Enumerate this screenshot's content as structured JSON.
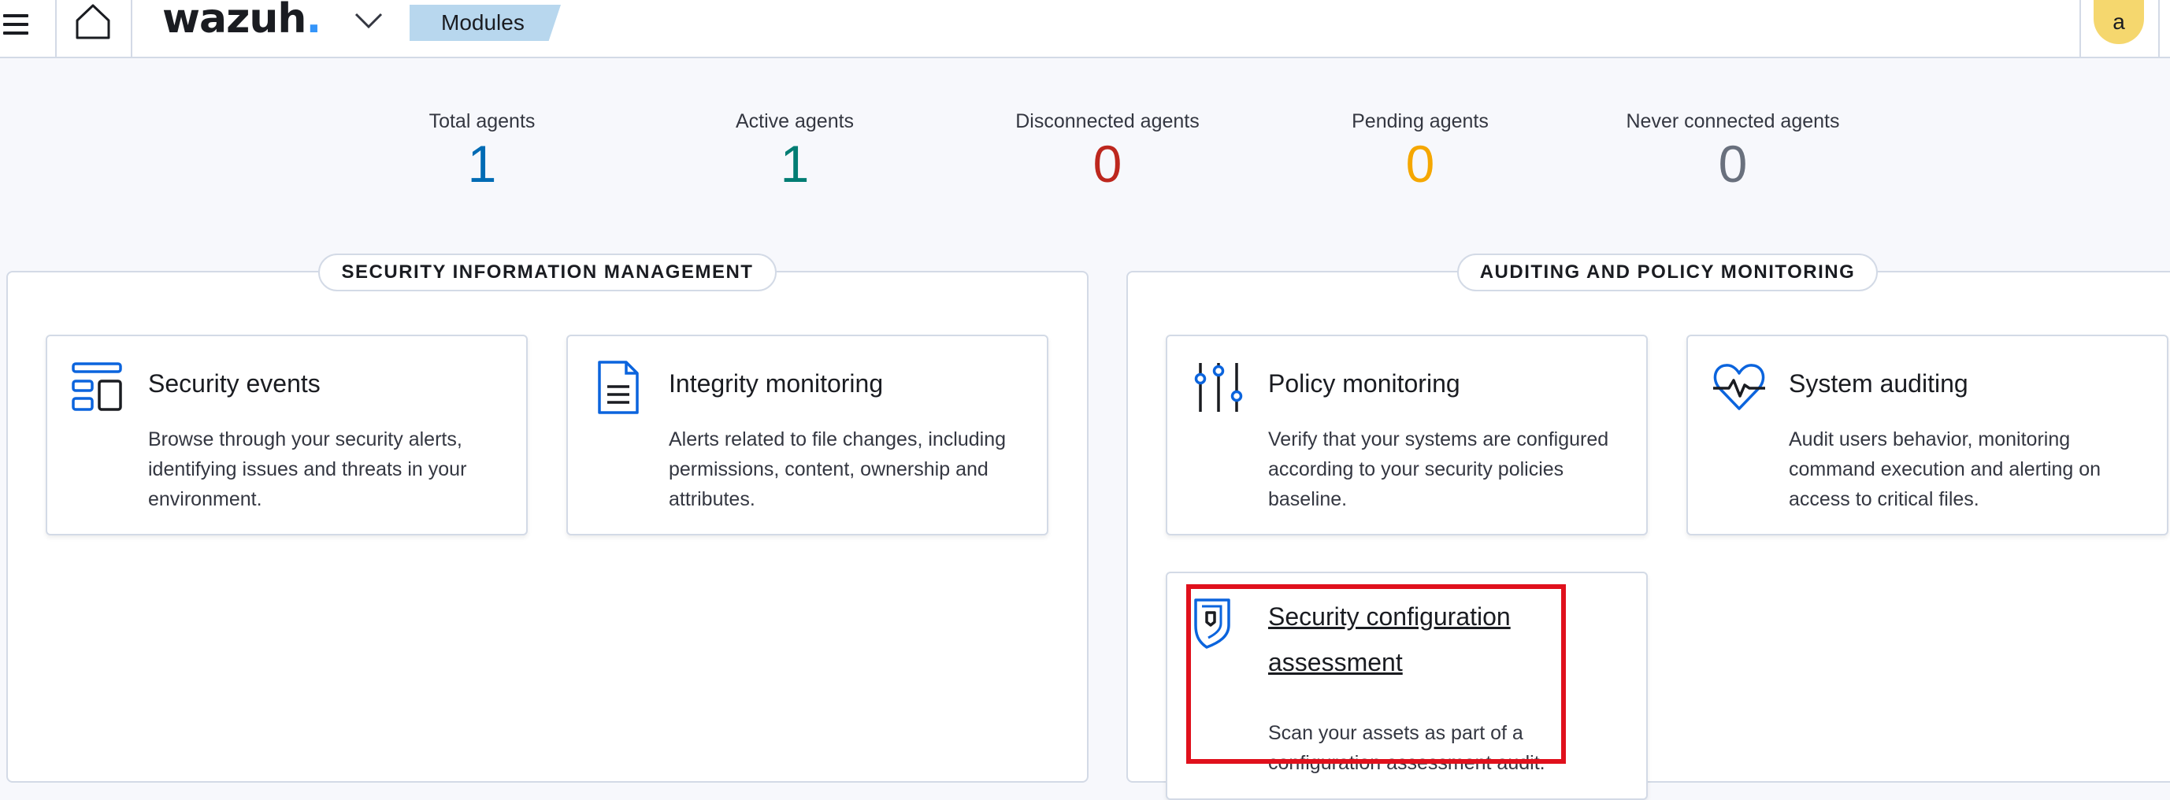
{
  "header": {
    "logo_text": "wazuh",
    "logo_dot": ".",
    "breadcrumb": "Modules",
    "avatar_initial": "a",
    "icons": [
      "menu-icon",
      "home-icon",
      "chevron-down-icon"
    ]
  },
  "stats": [
    {
      "label": "Total agents",
      "value": "1",
      "color": "#006bb4"
    },
    {
      "label": "Active agents",
      "value": "1",
      "color": "#017d73"
    },
    {
      "label": "Disconnected agents",
      "value": "0",
      "color": "#bd271e"
    },
    {
      "label": "Pending agents",
      "value": "0",
      "color": "#f5a700"
    },
    {
      "label": "Never connected agents",
      "value": "0",
      "color": "#69707d"
    }
  ],
  "sections": [
    {
      "title": "SECURITY INFORMATION MANAGEMENT",
      "cards": [
        {
          "title": "Security events",
          "icon": "dashboard-layout-icon",
          "description": "Browse through your security alerts, identifying issues and threats in your environment."
        },
        {
          "title": "Integrity monitoring",
          "icon": "document-icon",
          "description": "Alerts related to file changes, including permissions, content, ownership and attributes."
        }
      ]
    },
    {
      "title": "AUDITING AND POLICY MONITORING",
      "cards": [
        {
          "title": "Policy monitoring",
          "icon": "sliders-icon",
          "description": "Verify that your systems are configured according to your security policies baseline."
        },
        {
          "title": "System auditing",
          "icon": "heart-pulse-icon",
          "description": "Audit users behavior, monitoring command execution and alerting on access to critical files."
        },
        {
          "title": "Security configuration assessment",
          "icon": "shield-icon",
          "description": "Scan your assets as part of a configuration assessment audit."
        }
      ]
    }
  ],
  "colors": {
    "accent_blue": "#3595f9",
    "icon_blue": "#0b64dd",
    "highlight_red": "#e0101c",
    "breadcrumb_bg": "#b8d7ee",
    "avatar_bg": "#f5d76e"
  }
}
